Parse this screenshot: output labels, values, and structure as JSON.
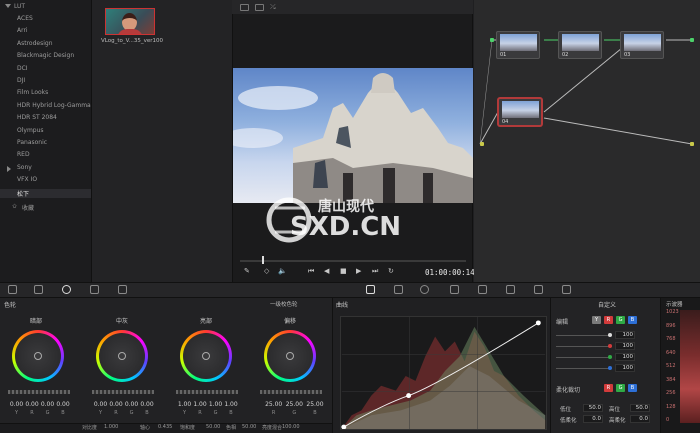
{
  "lut_browser": {
    "header": "LUT",
    "items": [
      "ACES",
      "Arri",
      "Astrodesign",
      "Blackmagic Design",
      "DCI",
      "DJI",
      "Film Looks",
      "HDR Hybrid Log-Gamma",
      "HDR ST 2084",
      "Olympus",
      "Panasonic",
      "RED",
      "Sony",
      "VFX IO",
      "松下"
    ],
    "selected": "松下",
    "favorites": "收藏",
    "thumb_caption": "VLog_to_V...35_ver100"
  },
  "viewer": {
    "timecode": "01:00:00:14"
  },
  "nodes": [
    {
      "label": "01"
    },
    {
      "label": "02"
    },
    {
      "label": "03"
    },
    {
      "label": "04"
    }
  ],
  "watermark": {
    "top": "唐山现代",
    "bottom": "SXD.CN"
  },
  "wheels": {
    "title": "色轮",
    "mode": "一级校色轮",
    "groups": [
      {
        "label": "暗部",
        "values": [
          "0.00",
          "0.00",
          "0.00",
          "0.00"
        ]
      },
      {
        "label": "中灰",
        "values": [
          "0.00",
          "0.00",
          "0.00",
          "0.00"
        ]
      },
      {
        "label": "亮部",
        "values": [
          "1.00",
          "1.00",
          "1.00",
          "1.00"
        ]
      },
      {
        "label": "偏移",
        "values": [
          "25.00",
          "25.00",
          "25.00"
        ]
      }
    ],
    "channels4": [
      "Y",
      "R",
      "G",
      "B"
    ],
    "channels3": [
      "R",
      "G",
      "B"
    ]
  },
  "bottom_bar": {
    "items": [
      "对比度",
      "1.000",
      "轴心",
      "0.435",
      "饱和度",
      "50.00",
      "色相",
      "50.00",
      "亮度混合",
      "100.00"
    ]
  },
  "curves": {
    "title": "曲线"
  },
  "edit_panel": {
    "mode": "自定义",
    "edit_label": "编辑",
    "values": [
      "100",
      "100",
      "100",
      "100"
    ],
    "soft_clip_label": "柔化裁切",
    "low_label": "低位",
    "low_val": "50.0",
    "high_label": "高位",
    "high_val": "50.0",
    "low_soft_label": "低柔化",
    "low_soft_val": "0.0",
    "high_soft_label": "高柔化",
    "high_soft_val": "0.0"
  },
  "scopes": {
    "title": "示波器",
    "ticks": [
      "1023",
      "896",
      "768",
      "640",
      "512",
      "384",
      "256",
      "128",
      "0"
    ]
  },
  "colors": {
    "accent_red": "#b23a3a",
    "chip_red": "#d23b3b",
    "chip_green": "#2faa45",
    "chip_blue": "#2d6fd6"
  }
}
